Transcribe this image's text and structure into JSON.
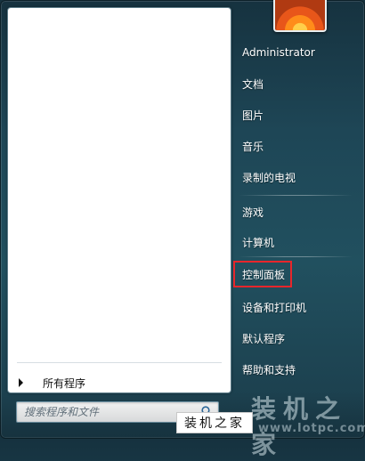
{
  "user": {
    "name": "Administrator"
  },
  "left_pane": {
    "all_programs_label": "所有程序",
    "search_placeholder": "搜索程序和文件"
  },
  "right_items": [
    {
      "label": "文档"
    },
    {
      "label": "图片"
    },
    {
      "label": "音乐"
    },
    {
      "label": "录制的电视"
    },
    {
      "label": "游戏"
    },
    {
      "label": "计算机"
    },
    {
      "label": "控制面板",
      "highlighted": true
    },
    {
      "label": "设备和打印机"
    },
    {
      "label": "默认程序"
    },
    {
      "label": "帮助和支持"
    }
  ],
  "watermark": {
    "site_name": "装机之家",
    "url": "www.lotpc.com",
    "label": "装机之家"
  },
  "colors": {
    "highlight_border": "#e8262b",
    "panel_background": "#1e4656"
  }
}
